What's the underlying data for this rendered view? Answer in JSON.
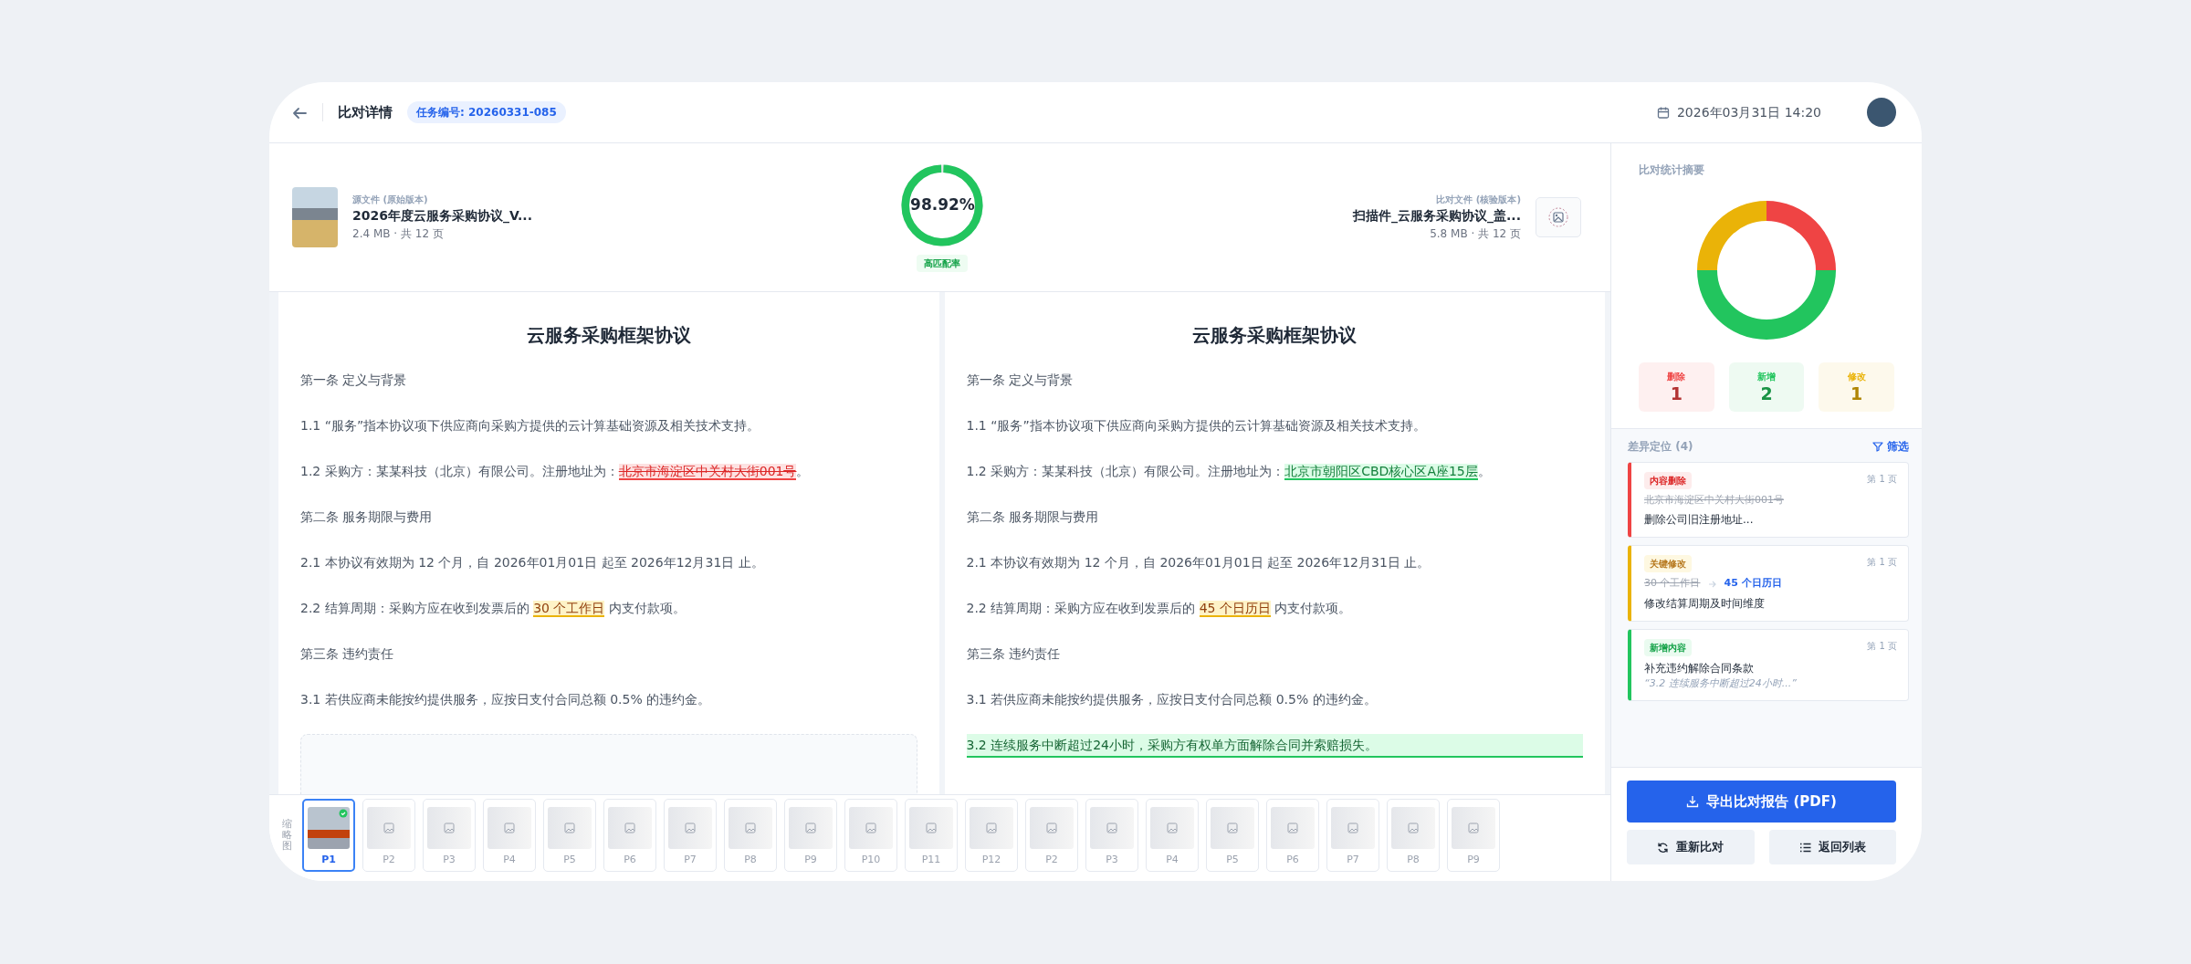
{
  "header": {
    "title": "比对详情",
    "task_badge": "任务编号: 20260331-085",
    "datetime": "2026年03月31日 14:20"
  },
  "source_file": {
    "caption": "源文件 (原始版本)",
    "name": "2026年度云服务采购协议_V...",
    "meta": "2.4 MB · 共 12 页"
  },
  "match": {
    "value": "98.92%",
    "level": 0.9892,
    "badge": "高匹配率"
  },
  "target_file": {
    "caption": "比对文件 (核验版本)",
    "name": "扫描件_云服务采购协议_盖...",
    "meta": "5.8 MB · 共 12 页"
  },
  "documents": [
    {
      "title": "云服务采购框架协议",
      "empty_block": true,
      "paragraphs": [
        {
          "kind": "heading",
          "segments": [
            {
              "text": "第一条 定义与背景"
            }
          ]
        },
        {
          "kind": "clause",
          "segments": [
            {
              "text": "1.1 “服务”指本协议项下供应商向采购方提供的云计算基础资源及相关技术支持。"
            }
          ]
        },
        {
          "kind": "clause",
          "segments": [
            {
              "text": "1.2 采购方：某某科技（北京）有限公司。注册地址为："
            },
            {
              "text": "北京市海淀区中关村大街001号",
              "kind": "deleted"
            },
            {
              "text": "。"
            }
          ]
        },
        {
          "kind": "heading",
          "segments": [
            {
              "text": "第二条 服务期限与费用"
            }
          ]
        },
        {
          "kind": "clause",
          "segments": [
            {
              "text": "2.1 本协议有效期为 12 个月，自 2026年01月01日 起至 2026年12月31日 止。"
            }
          ]
        },
        {
          "kind": "clause",
          "segments": [
            {
              "text": "2.2 结算周期：采购方应在收到发票后的 "
            },
            {
              "text": "30 个工作日",
              "kind": "changed"
            },
            {
              "text": " 内支付款项。"
            }
          ]
        },
        {
          "kind": "heading",
          "segments": [
            {
              "text": "第三条 违约责任"
            }
          ]
        },
        {
          "kind": "clause",
          "segments": [
            {
              "text": "3.1 若供应商未能按约提供服务，应按日支付合同总额 0.5% 的违约金。"
            }
          ]
        }
      ]
    },
    {
      "title": "云服务采购框架协议",
      "empty_block": false,
      "paragraphs": [
        {
          "kind": "heading",
          "segments": [
            {
              "text": "第一条 定义与背景"
            }
          ]
        },
        {
          "kind": "clause",
          "segments": [
            {
              "text": "1.1 “服务”指本协议项下供应商向采购方提供的云计算基础资源及相关技术支持。"
            }
          ]
        },
        {
          "kind": "clause",
          "segments": [
            {
              "text": "1.2 采购方：某某科技（北京）有限公司。注册地址为："
            },
            {
              "text": "北京市朝阳区CBD核心区A座15层",
              "kind": "added"
            },
            {
              "text": "。"
            }
          ]
        },
        {
          "kind": "heading",
          "segments": [
            {
              "text": "第二条 服务期限与费用"
            }
          ]
        },
        {
          "kind": "clause",
          "segments": [
            {
              "text": "2.1 本协议有效期为 12 个月，自 2026年01月01日 起至 2026年12月31日 止。"
            }
          ]
        },
        {
          "kind": "clause",
          "segments": [
            {
              "text": "2.2 结算周期：采购方应在收到发票后的 "
            },
            {
              "text": "45 个日历日",
              "kind": "changed"
            },
            {
              "text": " 内支付款项。"
            }
          ]
        },
        {
          "kind": "heading",
          "segments": [
            {
              "text": "第三条 违约责任"
            }
          ]
        },
        {
          "kind": "clause",
          "segments": [
            {
              "text": "3.1 若供应商未能按约提供服务，应按日支付合同总额 0.5% 的违约金。"
            }
          ]
        },
        {
          "kind": "added",
          "segments": [
            {
              "text": "3.2 连续服务中断超过24小时，采购方有权单方面解除合同并索赔损失。"
            }
          ]
        }
      ]
    }
  ],
  "thumbnails": {
    "label": "缩略图",
    "pages": [
      {
        "label": "P1",
        "kind": "photo",
        "selected": true
      },
      {
        "label": "P2",
        "kind": "placeholder",
        "selected": false
      },
      {
        "label": "P3",
        "kind": "placeholder",
        "selected": false
      },
      {
        "label": "P4",
        "kind": "placeholder",
        "selected": false
      },
      {
        "label": "P5",
        "kind": "placeholder",
        "selected": false
      },
      {
        "label": "P6",
        "kind": "placeholder",
        "selected": false
      },
      {
        "label": "P7",
        "kind": "placeholder",
        "selected": false
      },
      {
        "label": "P8",
        "kind": "placeholder",
        "selected": false
      },
      {
        "label": "P9",
        "kind": "placeholder",
        "selected": false
      },
      {
        "label": "P10",
        "kind": "placeholder",
        "selected": false
      },
      {
        "label": "P11",
        "kind": "placeholder",
        "selected": false
      },
      {
        "label": "P12",
        "kind": "placeholder",
        "selected": false
      },
      {
        "label": "P2",
        "kind": "placeholder",
        "selected": false
      },
      {
        "label": "P3",
        "kind": "placeholder",
        "selected": false
      },
      {
        "label": "P4",
        "kind": "placeholder",
        "selected": false
      },
      {
        "label": "P5",
        "kind": "placeholder",
        "selected": false
      },
      {
        "label": "P6",
        "kind": "placeholder",
        "selected": false
      },
      {
        "label": "P7",
        "kind": "placeholder",
        "selected": false
      },
      {
        "label": "P8",
        "kind": "placeholder",
        "selected": false
      },
      {
        "label": "P9",
        "kind": "placeholder",
        "selected": false
      }
    ]
  },
  "summary": {
    "title": "比对统计摘要",
    "chart_data": {
      "type": "donut",
      "values": [
        25,
        50,
        25
      ]
    },
    "stats": [
      {
        "label": "删除",
        "value": "1",
        "color": "#ef4444"
      },
      {
        "label": "新增",
        "value": "2",
        "color": "#22c55e"
      },
      {
        "label": "修改",
        "value": "1",
        "color": "#eab308"
      }
    ]
  },
  "diffs": {
    "title": "差异定位 (4)",
    "filter": "筛选",
    "items": [
      {
        "kind": "deleted",
        "tag": "内容删除",
        "page": "第 1 页",
        "old": "北京市海淀区中关村大街001号",
        "desc": "删除公司旧注册地址..."
      },
      {
        "kind": "changed",
        "tag": "关键修改",
        "page": "第 1 页",
        "old": "30 个工作日",
        "new": "45 个日历日",
        "desc": "修改结算周期及时间维度"
      },
      {
        "kind": "added",
        "tag": "新增内容",
        "page": "第 1 页",
        "desc": "补充违约解除合同条款",
        "quote": "“3.2 连续服务中断超过24小时...”"
      }
    ]
  },
  "actions": {
    "export": "导出比对报告 (PDF)",
    "rerun": "重新比对",
    "back": "返回列表"
  }
}
